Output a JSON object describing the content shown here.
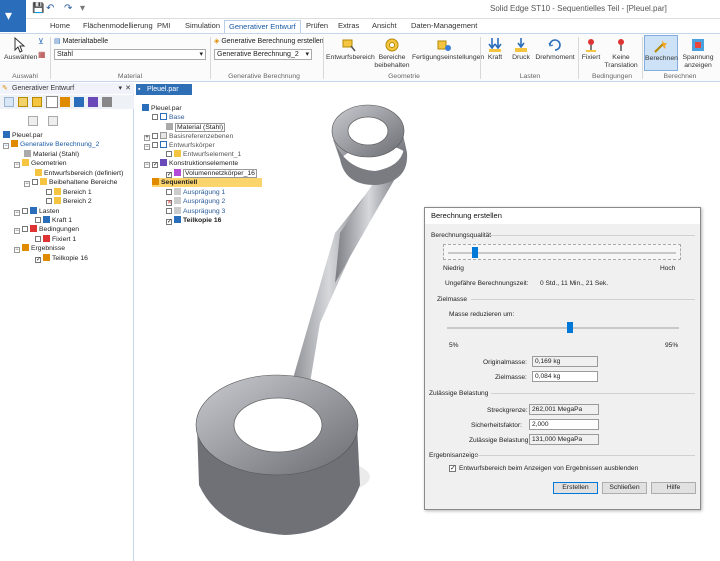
{
  "window": {
    "title": "Solid Edge ST10 - Sequentielles Teil - [Pleuel.par]"
  },
  "tabs": [
    "Home",
    "Flächenmodellierung",
    "PMI",
    "Simulation",
    "Generativer Entwurf",
    "Prüfen",
    "Extras",
    "Ansicht",
    "Daten-Management"
  ],
  "ribbon": {
    "select_label": "Auswählen",
    "select_group": "Auswahl",
    "material_table": "Materialtabelle",
    "material_value": "Stahl",
    "material_group": "Material",
    "create_study": "Generative Berechnung erstellen",
    "study_value": "Generative Berechnung_2",
    "study_group": "Generative Berechnung",
    "design_space": "Entwurfsbereich",
    "keep_regions": "Bereiche beibehalten",
    "manufacturing": "Fertigungseinstellungen",
    "geometry_group": "Geometrie",
    "force": "Kraft",
    "pressure": "Druck",
    "torque": "Drehmoment",
    "loads_group": "Lasten",
    "fixed": "Fixiert",
    "no_translation": "Keine Translation",
    "constraints_group": "Bedingungen",
    "compute": "Berechnen",
    "stress": "Spannung anzeigen",
    "results_group": "Berechnen"
  },
  "left_panel": {
    "header": "Generativer Entwurf",
    "tree": [
      {
        "label": "Pleuel.par"
      },
      {
        "label": "Generative Berechnung_2"
      },
      {
        "label": "Material (Stahl)"
      },
      {
        "label": "Geometrien"
      },
      {
        "label": "Entwurfsbereich (definiert)"
      },
      {
        "label": "Beibehaltene Bereiche"
      },
      {
        "label": "Bereich 1"
      },
      {
        "label": "Bereich 2"
      },
      {
        "label": "Lasten"
      },
      {
        "label": "Kraft 1"
      },
      {
        "label": "Bedingungen"
      },
      {
        "label": "Fixiert 1"
      },
      {
        "label": "Ergebnisse"
      },
      {
        "label": "Teilkopie 16"
      }
    ]
  },
  "doc_tab": "Pleuel.par",
  "feature_tree": [
    "Pleuel.par",
    "Base",
    "Material (Stahl)",
    "Basisreferenzebenen",
    "Entwurfskörper",
    "Entwurfselement_1",
    "Konstruktionselemente",
    "Volumennetzkörper_16",
    "Sequentiell",
    "Ausprägung 1",
    "Ausprägung 2",
    "Ausprägung 3",
    "Teilkopie 16"
  ],
  "dialog": {
    "title": "Berechnung erstellen",
    "quality_label": "Berechnungsqualität",
    "low": "Niedrig",
    "high": "Hoch",
    "approx_time_label": "Ungefähre Berechnungszeit:",
    "approx_time": "0 Std., 11 Min., 21 Sek.",
    "quality_level": 0.12,
    "target_mass_label": "Zielmasse",
    "reduce_mass_label": "Masse reduzieren um:",
    "min_pct": "5%",
    "max_pct": "95%",
    "mass_reduction_level": 0.53,
    "original_mass_label": "Originalmasse:",
    "original_mass": "0,169 kg",
    "target_mass_field_label": "Zielmasse:",
    "target_mass": "0,084 kg",
    "allowable_label": "Zulässige Belastung",
    "yield_label": "Streckgrenze:",
    "yield": "262,001 MegaPa",
    "safety_label": "Sicherheitsfaktor:",
    "safety": "2,000",
    "allowed_stress_label": "Zulässige Belastung:",
    "allowed_stress": "131,000 MegaPa",
    "results_display_label": "Ergebnisanzeige",
    "hide_design_space_label": "Entwurfsbereich beim Anzeigen von Ergebnissen ausblenden",
    "hide_design_space_checked": true,
    "create_btn": "Erstellen",
    "close_btn": "Schließen",
    "help_btn": "Hilfe"
  }
}
